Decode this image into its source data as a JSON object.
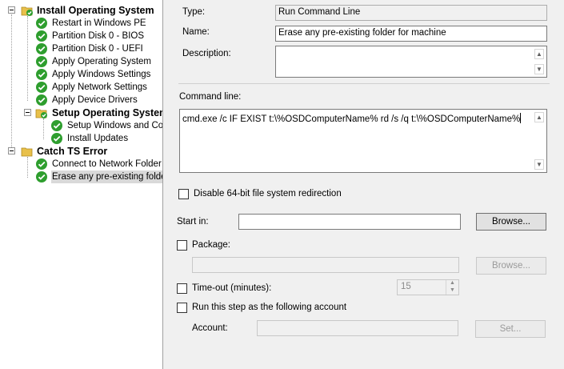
{
  "tree": {
    "items": [
      {
        "label": "Install Operating System",
        "type": "group"
      },
      {
        "label": "Restart in Windows PE",
        "type": "step"
      },
      {
        "label": "Partition Disk 0 - BIOS",
        "type": "step"
      },
      {
        "label": "Partition Disk 0 - UEFI",
        "type": "step"
      },
      {
        "label": "Apply Operating System",
        "type": "step"
      },
      {
        "label": "Apply Windows Settings",
        "type": "step"
      },
      {
        "label": "Apply Network Settings",
        "type": "step"
      },
      {
        "label": "Apply Device Drivers",
        "type": "step"
      },
      {
        "label": "Setup Operating System",
        "type": "group"
      },
      {
        "label": "Setup Windows and Con",
        "type": "step"
      },
      {
        "label": "Install Updates",
        "type": "step"
      },
      {
        "label": "Catch TS Error",
        "type": "group"
      },
      {
        "label": "Connect to Network Folder",
        "type": "step"
      },
      {
        "label": "Erase any pre-existing folder f",
        "type": "step",
        "selected": true
      }
    ]
  },
  "details": {
    "type_label": "Type:",
    "type_value": "Run Command Line",
    "name_label": "Name:",
    "name_value": "Erase any pre-existing folder for machine",
    "description_label": "Description:",
    "description_value": "",
    "command_line_label": "Command line:",
    "command_line_value": "cmd.exe /c IF EXIST t:\\%OSDComputerName% rd /s /q  t:\\%OSDComputerName%",
    "disable_redirection_label": "Disable 64-bit file system redirection",
    "disable_redirection_checked": false,
    "start_in_label": "Start in:",
    "start_in_value": "",
    "browse_label": "Browse...",
    "package_label": "Package:",
    "package_checked": false,
    "package_value": "",
    "package_browse_label": "Browse...",
    "timeout_label": "Time-out (minutes):",
    "timeout_checked": false,
    "timeout_value": "15",
    "run_as_label": "Run this step as the following account",
    "run_as_checked": false,
    "account_label": "Account:",
    "account_value": "",
    "set_label": "Set..."
  },
  "colors": {
    "check_green": "#2e9e2e",
    "folder_yellow": "#e8c04a",
    "selection_gray": "#d9d9d9"
  }
}
